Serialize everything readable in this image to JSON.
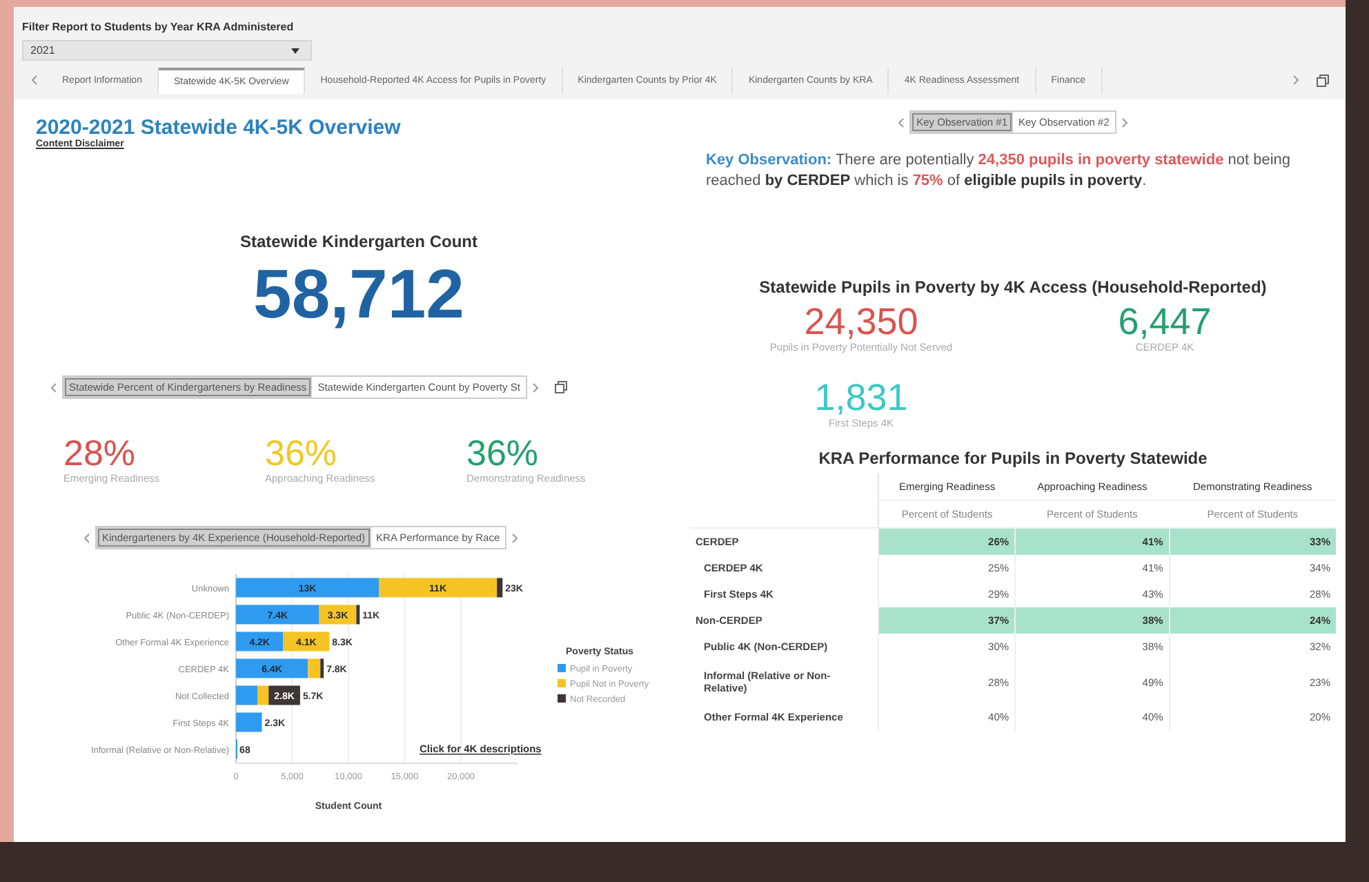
{
  "filter": {
    "label": "Filter Report to Students by Year KRA Administered",
    "value": "2021"
  },
  "report_tabs": [
    {
      "label": "Report Information",
      "selected": false
    },
    {
      "label": "Statewide 4K-5K Overview",
      "selected": true
    },
    {
      "label": "Household-Reported 4K Access for Pupils in Poverty",
      "selected": false
    },
    {
      "label": "Kindergarten Counts by Prior 4K",
      "selected": false
    },
    {
      "label": "Kindergarten Counts by KRA",
      "selected": false
    },
    {
      "label": "4K Readiness Assessment",
      "selected": false
    },
    {
      "label": "Finance",
      "selected": false
    }
  ],
  "overview": {
    "title": "2020-2021 Statewide 4K-5K Overview",
    "link": "Content Disclaimer",
    "count_title": "Statewide Kindergarten Count",
    "count": "58,712",
    "readiness_switcher": [
      {
        "label": "Statewide Percent of Kindergarteners by Readiness",
        "selected": true
      },
      {
        "label": "Statewide Kindergarten Count by Poverty St",
        "selected": false
      }
    ],
    "readiness": [
      {
        "value": "28%",
        "label": "Emerging Readiness",
        "color": "#d9534f"
      },
      {
        "value": "36%",
        "label": "Approaching Readiness",
        "color": "#f2c81e"
      },
      {
        "value": "36%",
        "label": "Demonstrating Readiness",
        "color": "#23a06e"
      }
    ],
    "chart_switcher": [
      {
        "label": "Kindergarteners by 4K Experience (Household-Reported)",
        "selected": true
      },
      {
        "label": "KRA Performance by Race",
        "selected": false
      }
    ],
    "chart_link": "Click for 4K descriptions",
    "legend_title": "Poverty Status",
    "chart_data": {
      "type": "bar",
      "orientation": "horizontal",
      "stacked": true,
      "xlabel": "Student Count",
      "xlim": [
        0,
        25000
      ],
      "grid": true,
      "legend": true,
      "categories": [
        "Unknown",
        "Public 4K (Non-CERDEP)",
        "Other Formal 4K Experience",
        "CERDEP 4K",
        "Not Collected",
        "First Steps 4K",
        "Informal (Relative or Non-Relative)"
      ],
      "series": [
        {
          "name": "Pupil in Poverty",
          "color": "#2f9bf0",
          "values": [
            12700,
            7400,
            4200,
            6400,
            1900,
            2300,
            68
          ],
          "value_labels": [
            "13K",
            "7.4K",
            "4.2K",
            "6.4K",
            null,
            null,
            null
          ]
        },
        {
          "name": "Pupil Not in Poverty",
          "color": "#f6c325",
          "values": [
            10500,
            3300,
            4100,
            1100,
            1000,
            0,
            0
          ],
          "value_labels": [
            "11K",
            "3.3K",
            "4.1K",
            null,
            null,
            null,
            null
          ]
        },
        {
          "name": "Not Recorded",
          "color": "#3d3536",
          "values": [
            500,
            300,
            0,
            300,
            2800,
            0,
            0
          ],
          "value_labels": [
            null,
            null,
            null,
            null,
            "2.8K",
            null,
            null
          ]
        }
      ],
      "annotations": [
        {
          "x": 23700,
          "text": "23K"
        },
        {
          "x": 11000,
          "text": "11K"
        },
        {
          "x": 8300,
          "text": "8.3K"
        },
        {
          "x": 7800,
          "text": "7.8K"
        },
        {
          "x": 5700,
          "text": "5.7K"
        },
        {
          "x": 2300,
          "text": "2.3K"
        },
        {
          "x": 68,
          "text": "68"
        }
      ],
      "xticks": [
        0,
        {
          "value": 5000,
          "label": "5,000"
        },
        {
          "value": 10000,
          "label": "10,000"
        },
        {
          "value": 15000,
          "label": "15,000"
        },
        {
          "value": 20000,
          "label": "20,000"
        }
      ]
    }
  },
  "observation": {
    "switcher": [
      {
        "label": "Key Observation #1",
        "selected": true
      },
      {
        "label": "Key Observation #2",
        "selected": false
      }
    ],
    "text": [
      {
        "text": "Key Observation:",
        "kind": "label"
      },
      {
        "text": " There are potentially ",
        "kind": "plain"
      },
      {
        "text": "24,350 pupils in poverty statewide",
        "kind": "alert"
      },
      {
        "text": " not being reached ",
        "kind": "plain"
      },
      {
        "text": "by CERDEP",
        "kind": "bold"
      },
      {
        "text": " which is ",
        "kind": "plain"
      },
      {
        "text": "75%",
        "kind": "alert"
      },
      {
        "text": " of ",
        "kind": "plain"
      },
      {
        "text": "eligible pupils in poverty",
        "kind": "bold"
      },
      {
        "text": ".",
        "kind": "plain"
      }
    ]
  },
  "poverty_access": {
    "title": "Statewide Pupils in Poverty by 4K Access (Household-Reported)",
    "stats": [
      {
        "value": "24,350",
        "label": "Pupils in Poverty Potentially Not Served",
        "color": "#d9534f"
      },
      {
        "value": "6,447",
        "label": "CERDEP 4K",
        "color": "#23a06e"
      },
      {
        "value": "1,831",
        "label": "First Steps 4K",
        "color": "#3cc8c8"
      }
    ]
  },
  "kra_table": {
    "title": "KRA Performance for Pupils in Poverty Statewide",
    "column_groups": [
      "Emerging Readiness",
      "Approaching Readiness",
      "Demonstrating Readiness"
    ],
    "subheaders": [
      "Percent of Students",
      "Percent of Students",
      "Percent of Students"
    ],
    "rows": [
      {
        "label": "CERDEP",
        "kind": "group",
        "values": [
          "26%",
          "41%",
          "33%"
        ]
      },
      {
        "label": "CERDEP 4K",
        "kind": "sub",
        "values": [
          "25%",
          "41%",
          "34%"
        ]
      },
      {
        "label": "First Steps 4K",
        "kind": "sub",
        "values": [
          "29%",
          "43%",
          "28%"
        ]
      },
      {
        "label": "Non-CERDEP",
        "kind": "group",
        "values": [
          "37%",
          "38%",
          "24%"
        ]
      },
      {
        "label": "Public 4K (Non-CERDEP)",
        "kind": "sub",
        "values": [
          "30%",
          "38%",
          "32%"
        ]
      },
      {
        "label": "Informal (Relative or Non-Relative)",
        "kind": "sub",
        "values": [
          "28%",
          "49%",
          "23%"
        ]
      },
      {
        "label": "Other Formal 4K Experience",
        "kind": "sub",
        "values": [
          "40%",
          "40%",
          "20%"
        ]
      }
    ]
  }
}
